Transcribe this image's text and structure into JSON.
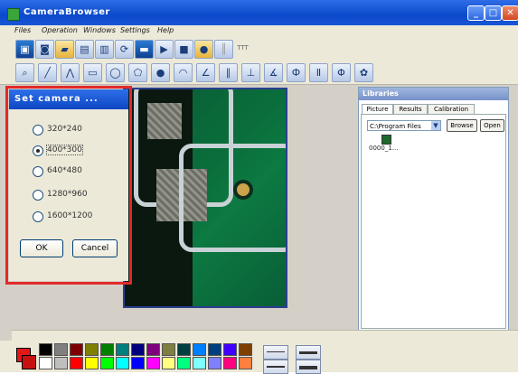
{
  "window": {
    "title": "CameraBrowser",
    "buttons": [
      "_",
      "□",
      "✕"
    ]
  },
  "menu": [
    "Files",
    "Operation",
    "Windows",
    "Settings",
    "Help"
  ],
  "toolbar1": [
    {
      "icon": "monitor-icon",
      "glyph": "▣",
      "style": "dark"
    },
    {
      "icon": "camera-icon",
      "glyph": "◙",
      "style": ""
    },
    {
      "icon": "folder-icon",
      "glyph": "▰",
      "style": "yellow"
    },
    {
      "icon": "image-open-icon",
      "glyph": "▤",
      "style": ""
    },
    {
      "icon": "image-save-icon",
      "glyph": "▥",
      "style": ""
    },
    {
      "icon": "refresh-icon",
      "glyph": "⟳",
      "style": ""
    },
    {
      "icon": "save-icon",
      "glyph": "▬",
      "style": "dark"
    },
    {
      "icon": "play-icon",
      "glyph": "▶",
      "style": ""
    },
    {
      "icon": "stop-icon",
      "glyph": "■",
      "style": ""
    },
    {
      "icon": "capture-icon",
      "glyph": "●",
      "style": "yellow"
    },
    {
      "icon": "ruler-icon",
      "glyph": "║",
      "style": "gray"
    },
    {
      "icon": "ttt-icon",
      "glyph": "TTT",
      "style": "ttt"
    }
  ],
  "toolbar2": [
    {
      "icon": "magnifier-icon",
      "glyph": "⌕"
    },
    {
      "icon": "line-icon",
      "glyph": "╱"
    },
    {
      "icon": "polyline-icon",
      "glyph": "⋀"
    },
    {
      "icon": "rectangle-icon",
      "glyph": "▭"
    },
    {
      "icon": "ellipse-icon",
      "glyph": "◯"
    },
    {
      "icon": "polygon-icon",
      "glyph": "⬠"
    },
    {
      "icon": "circle-icon",
      "glyph": "●"
    },
    {
      "icon": "arc-icon",
      "glyph": "◠"
    },
    {
      "icon": "angle-icon",
      "glyph": "∠"
    },
    {
      "icon": "parallel-icon",
      "glyph": "∥"
    },
    {
      "icon": "perpendicular-icon",
      "glyph": "⊥"
    },
    {
      "icon": "protractor-icon",
      "glyph": "∡"
    },
    {
      "icon": "vertical-measure-icon",
      "glyph": "Ф"
    },
    {
      "icon": "horizontal-measure-icon",
      "glyph": "Ⅱ"
    },
    {
      "icon": "point-measure-icon",
      "glyph": "Φ"
    },
    {
      "icon": "settings-icon",
      "glyph": "✿"
    }
  ],
  "dialog": {
    "title": "Set camera ...",
    "options": [
      "320*240",
      "400*300",
      "640*480",
      "1280*960",
      "1600*1200"
    ],
    "selected_index": 1,
    "ok_label": "OK",
    "cancel_label": "Cancel"
  },
  "libraries": {
    "title": "Libraries",
    "tabs": [
      "Picture",
      "Results",
      "Calibration"
    ],
    "path": "C:\\Program Files",
    "browse_label": "Browse",
    "open_label": "Open",
    "item_label": "0000_1..."
  },
  "palette": {
    "colors_row1": [
      "#000000",
      "#7f7f7f",
      "#7f0000",
      "#7f7f00",
      "#007f00",
      "#007f7f",
      "#00007f",
      "#7f007f",
      "#7f7f3f",
      "#003f3f",
      "#007fff",
      "#003f7f",
      "#3f00ff",
      "#7f3f00"
    ],
    "colors_row2": [
      "#ffffff",
      "#bfbfbf",
      "#ff0000",
      "#ffff00",
      "#00ff00",
      "#00ffff",
      "#0000ff",
      "#ff00ff",
      "#ffff7f",
      "#00ff7f",
      "#7fffff",
      "#7f7fff",
      "#ff007f",
      "#ff7f3f"
    ]
  }
}
